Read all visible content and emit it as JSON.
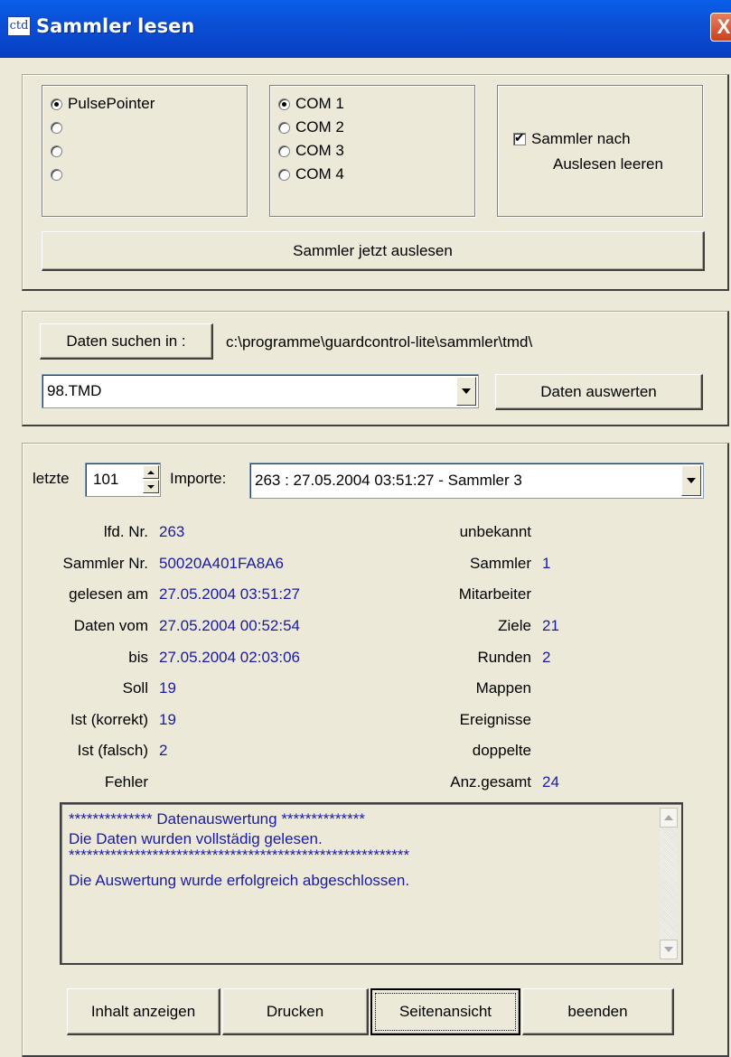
{
  "window": {
    "app_icon_text": "ctd",
    "title": "Sammler lesen",
    "close_symbol": "X"
  },
  "reader": {
    "devices": [
      {
        "label": "PulsePointer",
        "selected": true
      },
      {
        "label": "",
        "selected": false
      },
      {
        "label": "",
        "selected": false
      },
      {
        "label": "",
        "selected": false
      }
    ],
    "ports": [
      {
        "label": "COM 1",
        "selected": true
      },
      {
        "label": "COM 2",
        "selected": false
      },
      {
        "label": "COM 3",
        "selected": false
      },
      {
        "label": "COM 4",
        "selected": false
      }
    ],
    "clear_checkbox": {
      "line1": "Sammler nach",
      "line2": "Auslesen leeren",
      "checked": true
    },
    "read_button": "Sammler jetzt auslesen"
  },
  "data_source": {
    "search_button": "Daten suchen in :",
    "path": "c:\\programme\\guardcontrol-lite\\sammler\\tmd\\",
    "file_selected": "98.TMD",
    "evaluate_button": "Daten auswerten"
  },
  "imports": {
    "last_label": "letzte",
    "last_value": "101",
    "imports_label": "Importe:",
    "import_selected": "263 :  27.05.2004 03:51:27 - Sammler 3"
  },
  "details_left": [
    {
      "label": "lfd. Nr.",
      "value": "263"
    },
    {
      "label": "Sammler Nr.",
      "value": "50020A401FA8A6"
    },
    {
      "label": "gelesen am",
      "value": "27.05.2004 03:51:27"
    },
    {
      "label": "Daten vom",
      "value": "27.05.2004 00:52:54"
    },
    {
      "label": "bis",
      "value": "27.05.2004 02:03:06"
    },
    {
      "label": "Soll",
      "value": "19"
    },
    {
      "label": "Ist (korrekt)",
      "value": "19"
    },
    {
      "label": "Ist (falsch)",
      "value": "2"
    },
    {
      "label": "Fehler",
      "value": ""
    }
  ],
  "details_right": [
    {
      "label": "unbekannt",
      "value": ""
    },
    {
      "label": "Sammler",
      "value": "1"
    },
    {
      "label": "Mitarbeiter",
      "value": ""
    },
    {
      "label": "Ziele",
      "value": "21"
    },
    {
      "label": "Runden",
      "value": "2"
    },
    {
      "label": "Mappen",
      "value": ""
    },
    {
      "label": "Ereignisse",
      "value": ""
    },
    {
      "label": "doppelte",
      "value": ""
    },
    {
      "label": "Anz.gesamt",
      "value": "24"
    }
  ],
  "log": {
    "lines": [
      "************** Datenauswertung **************",
      "Die Daten wurden vollstädig gelesen.",
      "*********************************************************",
      "Die Auswertung wurde erfolgreich abgeschlossen."
    ]
  },
  "footer": {
    "show_content": "Inhalt anzeigen",
    "print": "Drucken",
    "page_view": "Seitenansicht",
    "close": "beenden"
  },
  "colors": {
    "value_text": "#1a1aa8",
    "dialog_bg": "#ece9d8",
    "titlebar": "#0a4fd6"
  }
}
